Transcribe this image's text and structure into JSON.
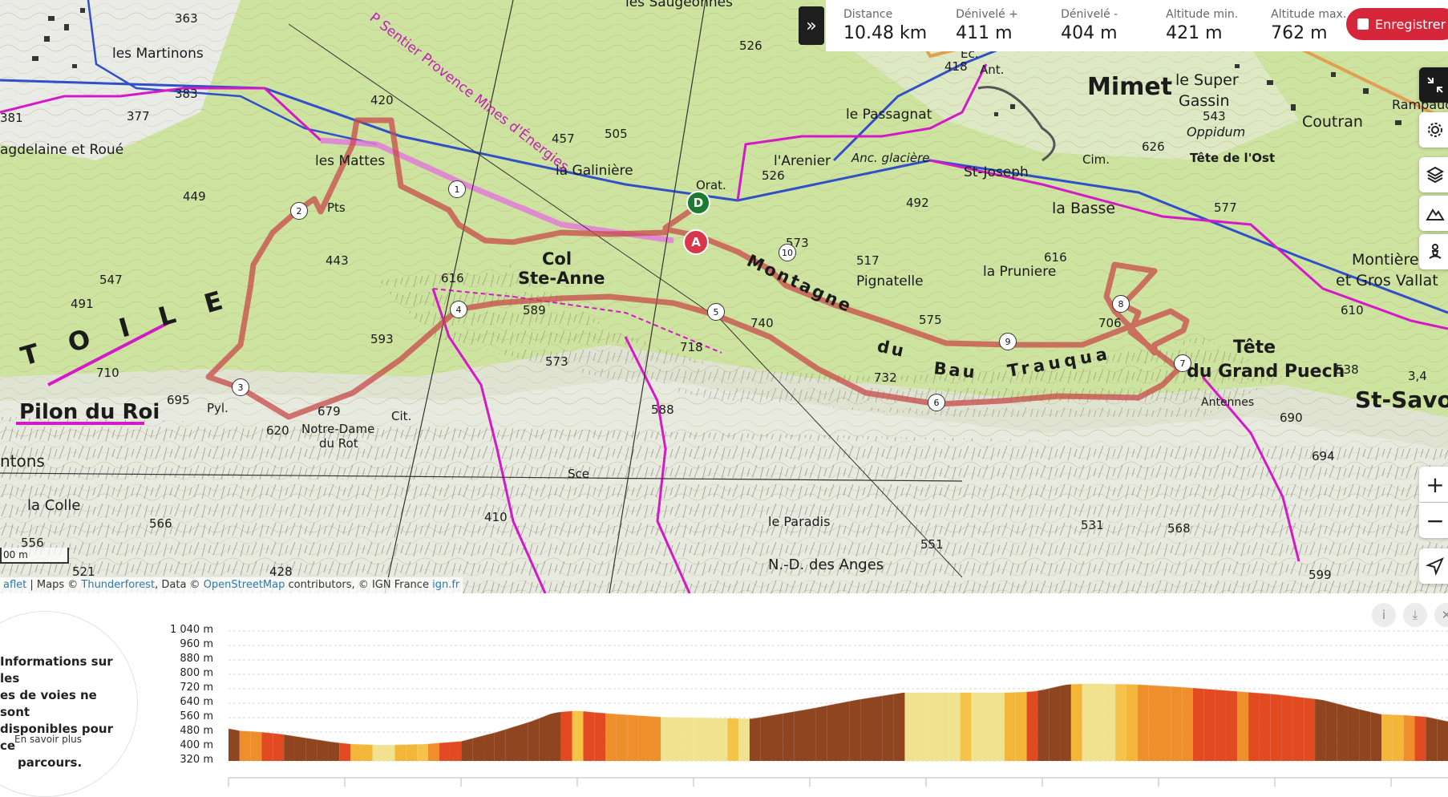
{
  "stats": {
    "distance": {
      "label": "Distance",
      "value": "10.48 km"
    },
    "gain": {
      "label": "Dénivelé +",
      "value": "411 m"
    },
    "loss": {
      "label": "Dénivelé -",
      "value": "404 m"
    },
    "alt_min": {
      "label": "Altitude min.",
      "value": "421 m"
    },
    "alt_max": {
      "label": "Altitude max.",
      "value": "762 m"
    }
  },
  "save_label": "Enregistrer",
  "map": {
    "markers": {
      "start": "D",
      "arrival": "A"
    },
    "waypoints": [
      "1",
      "2",
      "3",
      "4",
      "5",
      "6",
      "7",
      "8",
      "9",
      "10"
    ],
    "place_labels": {
      "martinons": "les Martinons",
      "magdelaine": "agdelaine et Roué",
      "mattes": "les Mattes",
      "galiniere": "la Galinière",
      "passagnat": "le Passagnat",
      "arenier": "l'Arenier",
      "glaciere": "Anc. glacière",
      "stjoseph": "St-Joseph",
      "mimet": "Mimet",
      "super_gassin": "le Super",
      "gassin": "Gassin",
      "coutran": "Coutran",
      "oppidum": "Oppidum",
      "tete_ost": "Tête de l'Ost",
      "basse": "la Basse",
      "pruniere": "la Pruniere",
      "pignatelle": "Pignatelle",
      "col": "Col",
      "ste_anne": "Ste-Anne",
      "montagne": "Montagne",
      "du": "du",
      "bau": "Bau",
      "trauqua": "Trauqua",
      "tete": "Tête",
      "grand_puech": "du Grand Puech",
      "montiere": "Montière",
      "gros_vallat": "et Gros Vallat",
      "st_savournin": "St-Savou",
      "pilon": "Pilon du Roi",
      "notre_dame": "Notre-Dame",
      "du_rot": "du Rot",
      "la_colle": "la Colle",
      "paradis": "le Paradis",
      "nd_anges": "N.-D. des Anges",
      "toile": "T O I L E",
      "gr_sentier": "P Sentier Provence Mines d'Énergies",
      "antennes": "Antennes",
      "orat": "Orat.",
      "sauge": "les Saugeonnes",
      "rampauds": "Rampauds",
      "cantons": "ntons"
    },
    "elevations": [
      "363",
      "383",
      "377",
      "381",
      "420",
      "457",
      "505",
      "526",
      "526",
      "418",
      "543",
      "492",
      "616",
      "626",
      "577",
      "610",
      "449",
      "443",
      "547",
      "491",
      "616",
      "589",
      "593",
      "573",
      "718",
      "740",
      "732",
      "706",
      "575",
      "517",
      "573",
      "710",
      "695",
      "620",
      "679",
      "588",
      "410",
      "566",
      "556",
      "521",
      "428",
      "551",
      "531",
      "568",
      "599",
      "694",
      "690",
      "538",
      "3,4",
      "Pts",
      "Cit.",
      "Pyl.",
      "Sce",
      "Cim.",
      "Ec.",
      "Ant."
    ],
    "scale_label": "00 m",
    "attribution": {
      "leaflet": "aflet",
      "maps_prefix": "| Maps ©",
      "thunderforest": "Thunderforest",
      "data_prefix": ", Data ©",
      "osm": "OpenStreetMap",
      "contrib": "contributors, © IGN France",
      "ign": "ign.fr"
    }
  },
  "profile": {
    "info_text": "Informations sur les es de voies ne sont disponibles pour ce parcours.",
    "info_lines": [
      "Informations sur les",
      "es de voies ne sont",
      "disponibles pour ce",
      "parcours."
    ],
    "info_link": "En savoir plus",
    "y_labels": [
      "1 040 m",
      "960 m",
      "880 m",
      "800 m",
      "720 m",
      "640 m",
      "560 m",
      "480 m",
      "400 m",
      "320 m"
    ],
    "y_values": [
      1040,
      960,
      880,
      800,
      720,
      640,
      560,
      480,
      400,
      320
    ],
    "tools": [
      "info-icon",
      "download-icon",
      "close-icon"
    ]
  },
  "chart_data": {
    "type": "area",
    "title": "",
    "xlabel": "",
    "ylabel": "",
    "ylim": [
      320,
      1040
    ],
    "x_km": [
      0,
      0.05,
      0.1,
      0.2,
      0.3,
      0.45,
      0.6,
      0.75,
      0.9,
      1.05,
      1.25,
      1.45,
      1.7,
      2.0,
      2.3,
      2.6,
      2.8,
      3.0,
      3.15,
      3.35,
      3.7,
      4.1,
      4.5,
      5.0,
      5.4,
      5.8,
      6.1,
      6.4,
      6.7,
      6.9,
      7.0,
      7.1,
      7.2,
      7.4,
      7.8,
      8.2,
      8.6,
      9.0,
      9.4,
      9.7,
      9.9,
      10.1,
      10.3,
      10.48
    ],
    "elevation_m": [
      500,
      495,
      488,
      485,
      480,
      470,
      455,
      440,
      425,
      415,
      410,
      410,
      415,
      430,
      480,
      540,
      590,
      600,
      590,
      580,
      565,
      560,
      555,
      610,
      660,
      700,
      700,
      700,
      700,
      705,
      715,
      730,
      745,
      750,
      745,
      730,
      710,
      690,
      660,
      610,
      580,
      575,
      565,
      540
    ]
  }
}
